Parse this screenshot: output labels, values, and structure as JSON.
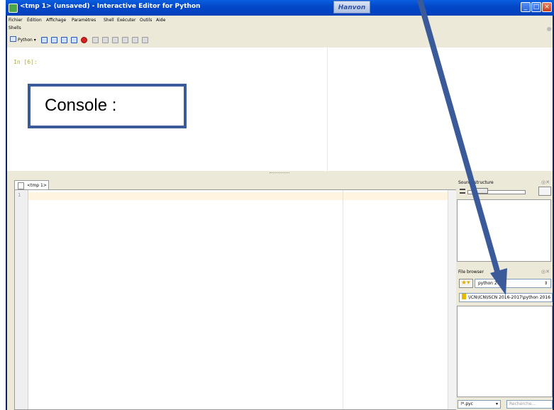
{
  "window": {
    "title": "<tmp 1> (unsaved) - Interactive Editor for Python",
    "hanvon_label": "Hanvon"
  },
  "menu": {
    "items": [
      "Fichier",
      "Édition",
      "Affichage",
      "Paramètres",
      "Shell",
      "Exécuter",
      "Outils",
      "Aide"
    ]
  },
  "shells": {
    "label": "Shells",
    "python_dropdown": "Python"
  },
  "console": {
    "prompt": "In [6]:"
  },
  "callout": {
    "text": "Console :"
  },
  "editor": {
    "tab_label": "<tmp 1>",
    "line_number": "1"
  },
  "source_structure": {
    "title": "Source structure"
  },
  "file_browser": {
    "title": "File browser",
    "directory": "python 2016",
    "path": "\\ICN\\ICN\\ISCN 2016-2017\\python 2016",
    "filter": "!*.pyc",
    "search_placeholder": "Recherche..."
  },
  "colors": {
    "titlebar": "#0348c9",
    "prompt": "#b5b500",
    "callout_border": "#3b5a9a",
    "arrow": "#3b5a9a"
  }
}
